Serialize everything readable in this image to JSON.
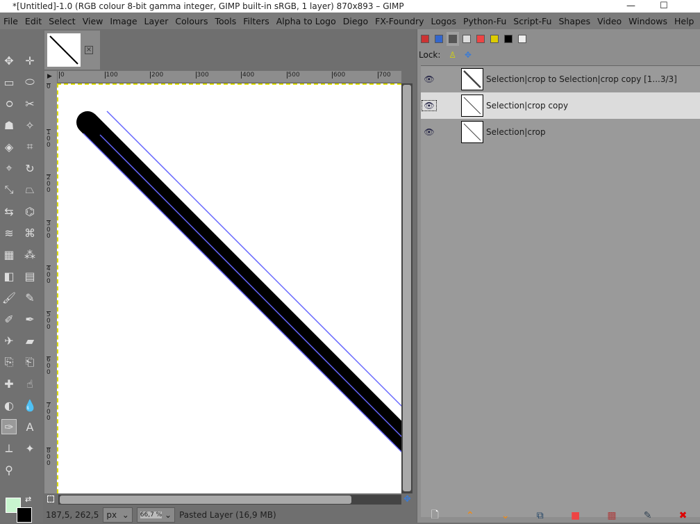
{
  "window": {
    "title": "*[Untitled]-1.0 (RGB colour 8-bit gamma integer, GIMP built-in sRGB, 1 layer) 870x893 – GIMP",
    "minimize": "—",
    "maximize": "☐"
  },
  "menu": [
    "File",
    "Edit",
    "Select",
    "View",
    "Image",
    "Layer",
    "Colours",
    "Tools",
    "Filters",
    "Alpha to Logo",
    "Diego",
    "FX-Foundry",
    "Logos",
    "Python-Fu",
    "Script-Fu",
    "Shapes",
    "Video",
    "Windows",
    "Help"
  ],
  "tools": [
    "move-tool",
    "alignment-tool",
    "rect-select-tool",
    "ellipse-select-tool",
    "free-select-tool",
    "scissors-select-tool",
    "foreground-select-tool",
    "fuzzy-select-tool",
    "color-select-tool",
    "crop-tool",
    "unified-transform-tool",
    "rotate-tool",
    "scale-tool",
    "perspective-tool",
    "flip-tool",
    "cage-tool",
    "warp-tool",
    "handle-transform-tool",
    "gegl-tool",
    "nodes-tool",
    "bucket-fill-tool",
    "gradient-tool",
    "paintbrush-tool",
    "pencil-tool",
    "color-picker-tool",
    "ink-tool",
    "airbrush-tool",
    "eraser-tool",
    "clone-tool",
    "perspective-clone-tool",
    "heal-tool",
    "smudge-tool",
    "dodge-burn-tool",
    "blur-tool",
    "paths-tool",
    "text-tool",
    "measure-tool",
    "mypaint-brush-tool",
    "zoom-tool"
  ],
  "colors": {
    "foreground": "#c8f5cf",
    "background": "#000000",
    "canvas": "#ffffff",
    "path": "#6666ff"
  },
  "image_tab": {
    "close": "×"
  },
  "ruler": {
    "h": [
      "0",
      "100",
      "200",
      "300",
      "400",
      "500",
      "600",
      "700"
    ],
    "v": [
      "0",
      "100",
      "200",
      "300",
      "400",
      "500",
      "600",
      "700",
      "800"
    ]
  },
  "status": {
    "coords": "187,5, 262,5",
    "unit": "px",
    "zoom": "66,7 %",
    "info": "Pasted Layer (16,9 MB)"
  },
  "panel": {
    "tabs": [
      "layers",
      "channels",
      "paths",
      "undo-history",
      "colormap",
      "undo",
      "brushes",
      "pointer"
    ],
    "lock_label": "Lock:",
    "paths": [
      {
        "name": "Selection|crop to Selection|crop copy [1...3/3]",
        "visible": true,
        "active": false
      },
      {
        "name": "Selection|crop copy",
        "visible": true,
        "active": true
      },
      {
        "name": "Selection|crop",
        "visible": true,
        "active": false
      }
    ],
    "actions": [
      "new-path",
      "raise-path",
      "lower-path",
      "duplicate-path",
      "path-to-selection",
      "selection-to-path",
      "stroke-path",
      "delete-path"
    ]
  }
}
